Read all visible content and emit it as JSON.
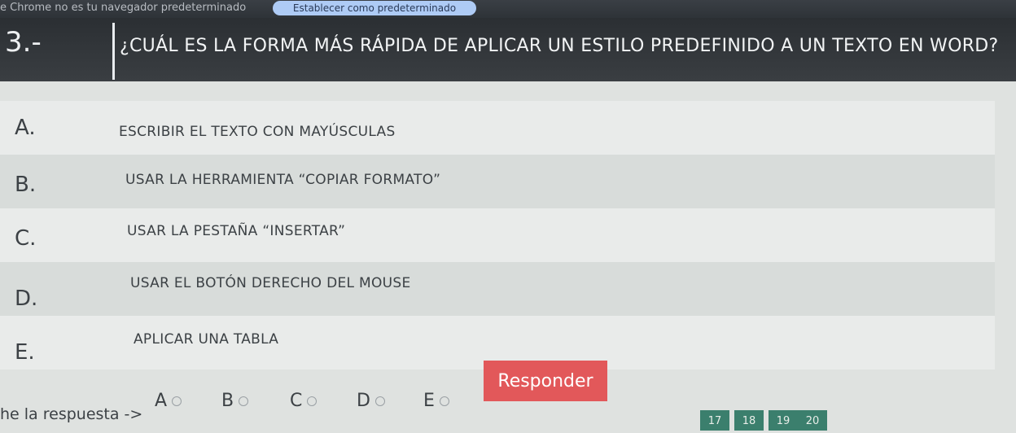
{
  "browser": {
    "default_message": "e Chrome no es tu navegador predeterminado",
    "set_default_button": "Establecer como predeterminado"
  },
  "question": {
    "number": "3.-",
    "text": "¿CUÁL ES LA FORMA MÁS RÁPIDA DE APLICAR UN ESTILO PREDEFINIDO A UN TEXTO EN WORD?"
  },
  "options": [
    {
      "letter": "A.",
      "text": "ESCRIBIR EL TEXTO CON MAYÚSCULAS"
    },
    {
      "letter": "B.",
      "text": "USAR LA HERRAMIENTA “COPIAR FORMATO”"
    },
    {
      "letter": "C.",
      "text": "USAR LA PESTAÑA “INSERTAR”"
    },
    {
      "letter": "D.",
      "text": "USAR EL BOTÓN DERECHO DEL MOUSE"
    },
    {
      "letter": "E.",
      "text": "APLICAR UNA TABLA"
    }
  ],
  "answer": {
    "label": "he la respuesta ->",
    "choices": [
      "A",
      "B",
      "C",
      "D",
      "E"
    ],
    "submit_label": "Responder"
  },
  "pagination": [
    "17",
    "18",
    "19",
    "20"
  ]
}
